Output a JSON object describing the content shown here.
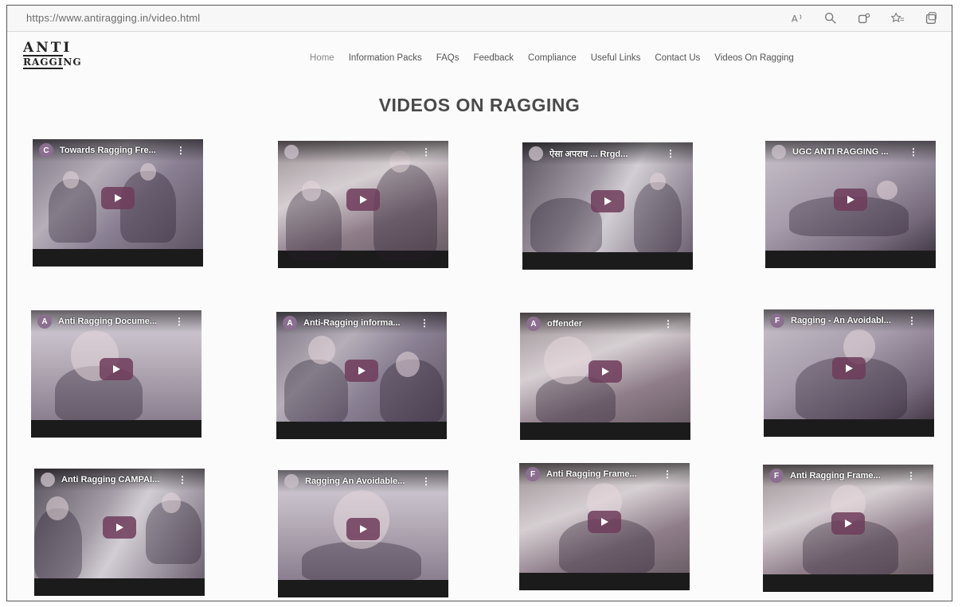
{
  "browser": {
    "url": "https://www.antiragging.in/video.html",
    "toolbar_icons": [
      "read-aloud-icon",
      "zoom-icon",
      "extensions-icon",
      "favorites-icon",
      "collections-icon"
    ]
  },
  "site": {
    "logo_line1": "ANTI",
    "logo_line2": "RAGGING"
  },
  "nav": {
    "items": [
      "Home",
      "Information Packs",
      "FAQs",
      "Feedback",
      "Compliance",
      "Useful Links",
      "Contact Us",
      "Videos On Ragging"
    ]
  },
  "page": {
    "title": "VIDEOS ON RAGGING"
  },
  "videos": [
    {
      "channel": "C",
      "title": "Towards Ragging Fre..."
    },
    {
      "channel": "",
      "title": ""
    },
    {
      "channel": "",
      "title": "ऐसा अपराध ... Rrgd..."
    },
    {
      "channel": "",
      "title": "UGC ANTI RAGGING ..."
    },
    {
      "channel": "A",
      "title": "Anti Ragging Docume..."
    },
    {
      "channel": "A",
      "title": "Anti-Ragging informa..."
    },
    {
      "channel": "A",
      "title": "offender"
    },
    {
      "channel": "F",
      "title": "Ragging - An Avoidabl..."
    },
    {
      "channel": "",
      "title": "Anti Ragging CAMPAI..."
    },
    {
      "channel": "",
      "title": "Ragging An Avoidable..."
    },
    {
      "channel": "F",
      "title": "Anti Ragging Frame..."
    },
    {
      "channel": "F",
      "title": "Anti Ragging Frame..."
    }
  ],
  "colors": {
    "play_button": "#6e3c5a",
    "title_text": "#4a4a4a"
  }
}
